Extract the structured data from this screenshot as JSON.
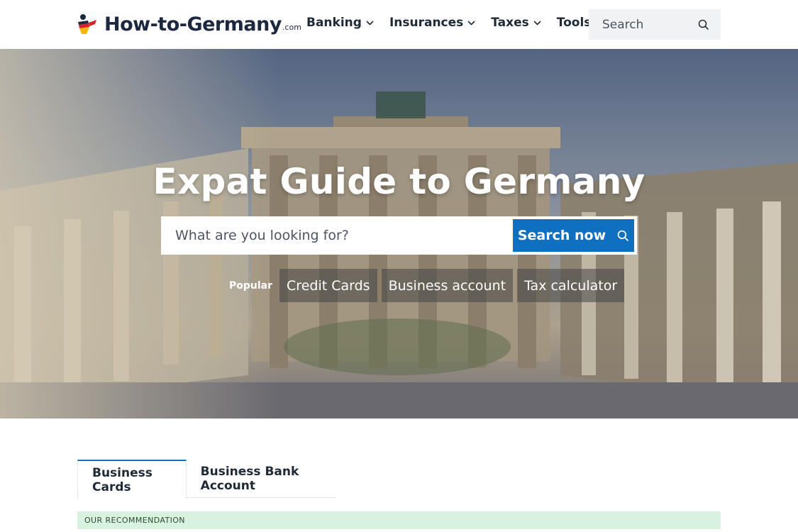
{
  "header": {
    "logo_text": "How-to-Germany",
    "logo_tld": ".com",
    "nav": [
      {
        "label": "Banking"
      },
      {
        "label": "Insurances"
      },
      {
        "label": "Taxes"
      },
      {
        "label": "Tools"
      }
    ],
    "search_placeholder": "Search"
  },
  "hero": {
    "title": "Expat Guide to Germany",
    "search_placeholder": "What are you looking for?",
    "search_button": "Search now",
    "popular_label": "Popular",
    "chips": [
      {
        "label": "Credit Cards"
      },
      {
        "label": "Business account"
      },
      {
        "label": "Tax calculator"
      }
    ]
  },
  "tabs": [
    {
      "label": "Business Cards",
      "active": true
    },
    {
      "label": "Business Bank Account",
      "active": false
    }
  ],
  "recommendation": {
    "label": "OUR RECOMMENDATION"
  },
  "colors": {
    "accent": "#0f6fc1",
    "brand_red": "#d8222a",
    "brand_yellow": "#f5b800",
    "recommend_bg": "#d9f2df"
  },
  "icons": {
    "logo": "person-flag-icon",
    "chevron": "chevron-down-icon",
    "search": "search-icon"
  }
}
